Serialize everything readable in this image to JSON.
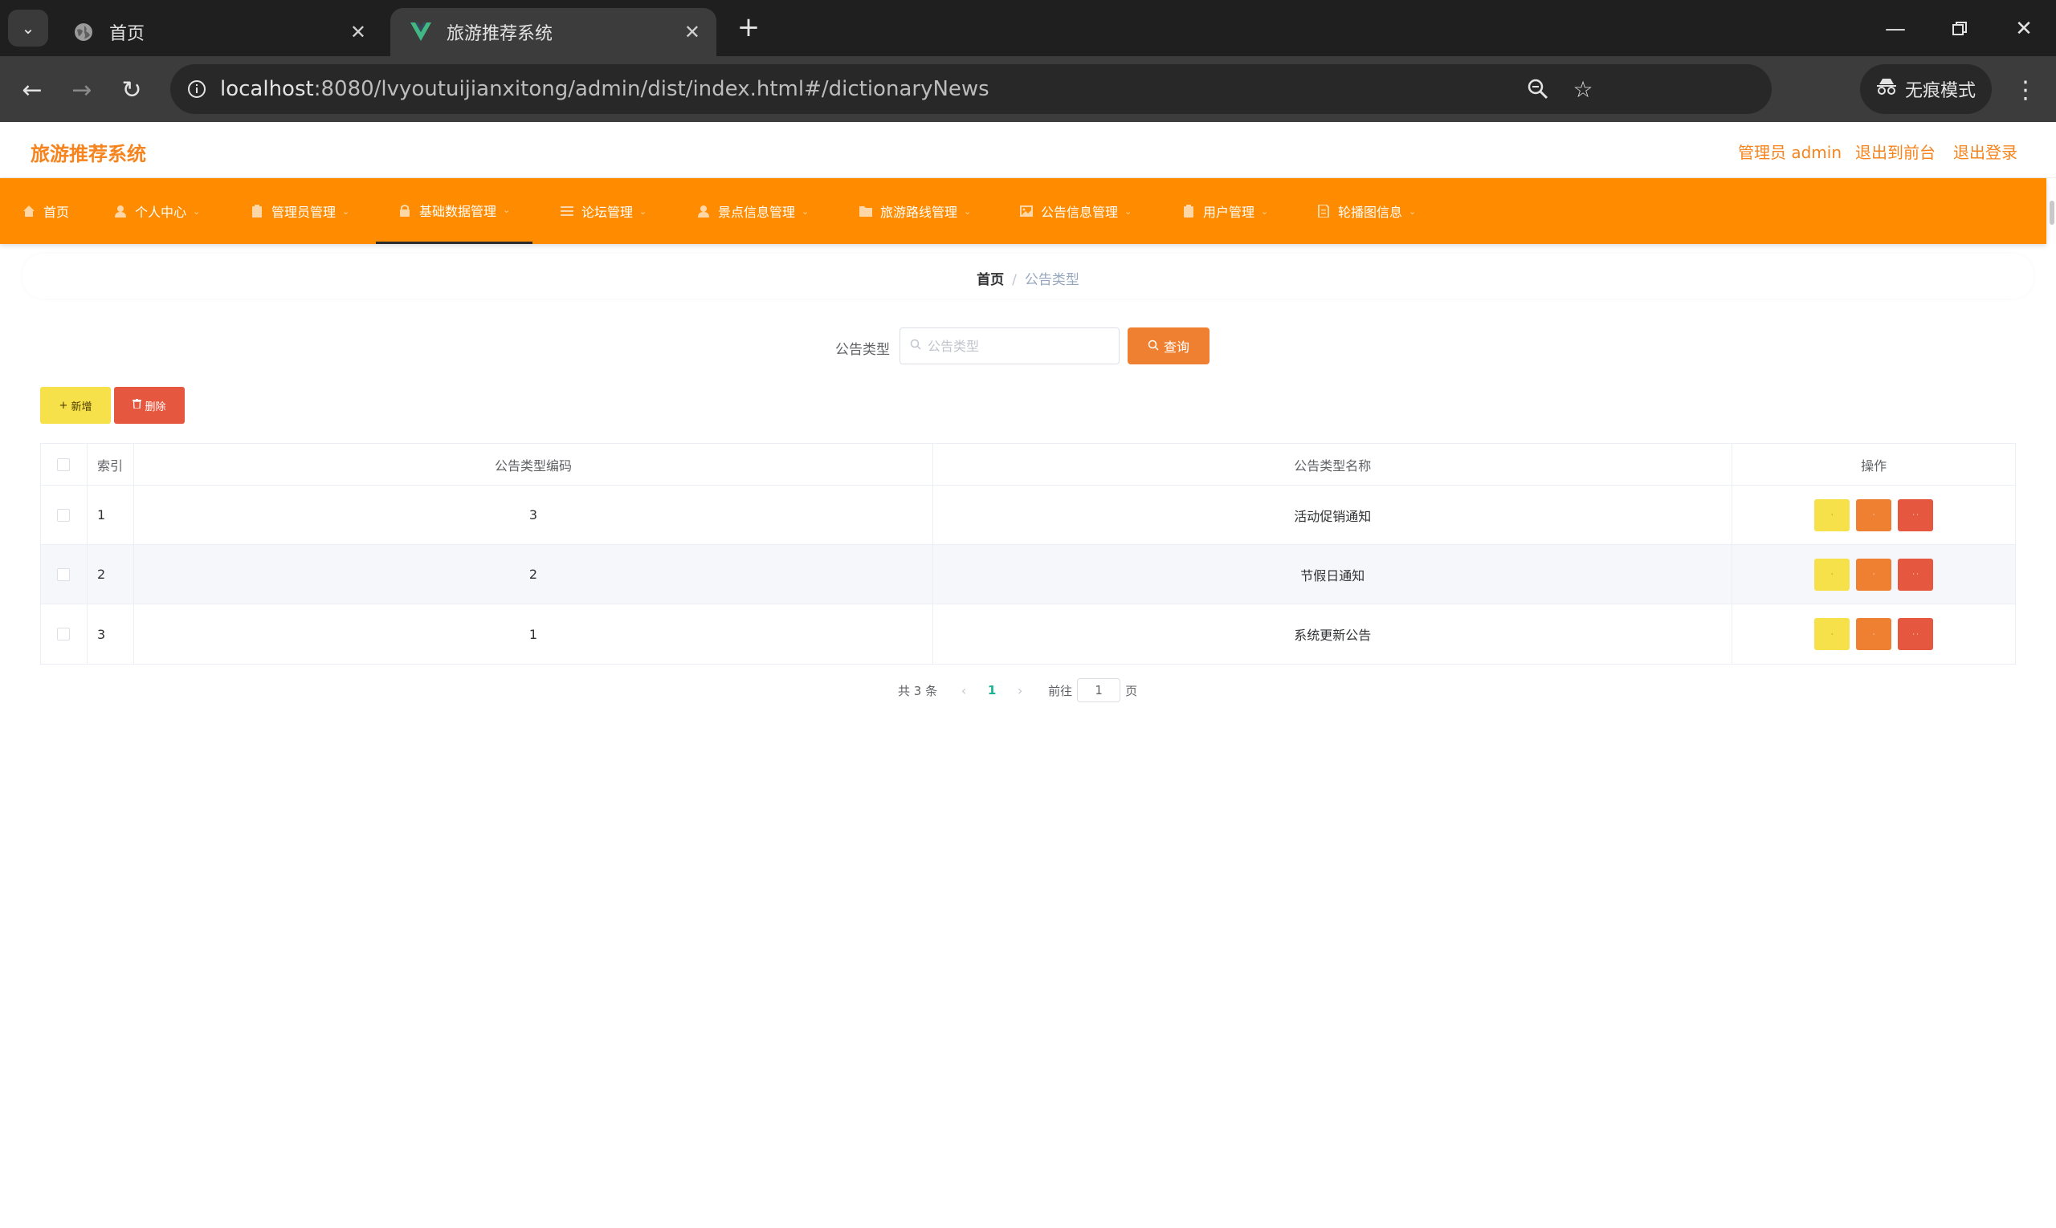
{
  "browser": {
    "tabs": [
      {
        "title": "首页",
        "favicon": "globe-icon",
        "active": false
      },
      {
        "title": "旅游推荐系统",
        "favicon": "vue-logo-icon",
        "active": true
      }
    ],
    "url_host": "localhost",
    "url_rest": ":8080/lvyoutuijianxitong/admin/dist/index.html#/dictionaryNews",
    "incognito_label": "无痕模式"
  },
  "header": {
    "title": "旅游推荐系统",
    "user_label": "管理员 admin",
    "front_link": "退出到前台",
    "logout_link": "退出登录"
  },
  "nav": {
    "items": [
      {
        "label": "首页",
        "icon": "home-icon"
      },
      {
        "label": "个人中心",
        "icon": "user-icon"
      },
      {
        "label": "管理员管理",
        "icon": "clipboard-icon"
      },
      {
        "label": "基础数据管理",
        "icon": "lock-icon"
      },
      {
        "label": "论坛管理",
        "icon": "list-icon"
      },
      {
        "label": "景点信息管理",
        "icon": "user-icon"
      },
      {
        "label": "旅游路线管理",
        "icon": "folder-icon"
      },
      {
        "label": "公告信息管理",
        "icon": "picture-icon"
      },
      {
        "label": "用户管理",
        "icon": "clipboard-icon"
      },
      {
        "label": "轮播图信息",
        "icon": "document-icon"
      }
    ],
    "active_index": 3
  },
  "breadcrumb": {
    "home": "首页",
    "separator": "/",
    "current": "公告类型"
  },
  "search": {
    "label": "公告类型",
    "placeholder": "公告类型",
    "button": "查询"
  },
  "actions": {
    "add": "新增",
    "delete": "删除"
  },
  "table": {
    "headers": {
      "index": "索引",
      "code": "公告类型编码",
      "name": "公告类型名称",
      "ops": "操作"
    },
    "rows": [
      {
        "index": "1",
        "code": "3",
        "name": "活动促销通知"
      },
      {
        "index": "2",
        "code": "2",
        "name": "节假日通知"
      },
      {
        "index": "3",
        "code": "1",
        "name": "系统更新公告"
      }
    ]
  },
  "pagination": {
    "total": "共 3 条",
    "current_page": "1",
    "goto_label": "前往",
    "goto_value": "1",
    "page_suffix": "页"
  },
  "colors": {
    "accent": "#ff8c00",
    "brand_text": "#f5841f",
    "view_button": "#f7e14b",
    "edit_button": "#f08031",
    "delete_button": "#e5573f",
    "page_active": "#1ab394"
  }
}
